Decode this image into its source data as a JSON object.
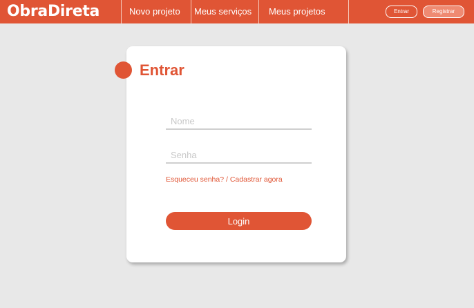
{
  "colors": {
    "accent": "#e05535",
    "background": "#e8e8e8",
    "card": "#ffffff"
  },
  "header": {
    "brand": "ObraDireta",
    "nav": {
      "novo_projeto": "Novo projeto",
      "meus_servicos": "Meus serviços",
      "meus_projetos": "Meus projetos"
    },
    "entrar_label": "Entrar",
    "registrar_label": "Registrar"
  },
  "login": {
    "title": "Entrar",
    "nome_placeholder": "Nome",
    "senha_placeholder": "Senha",
    "forgot_link": "Esqueceu senha?",
    "separator": " / ",
    "signup_link": "Cadastrar agora",
    "submit_label": "Login"
  }
}
